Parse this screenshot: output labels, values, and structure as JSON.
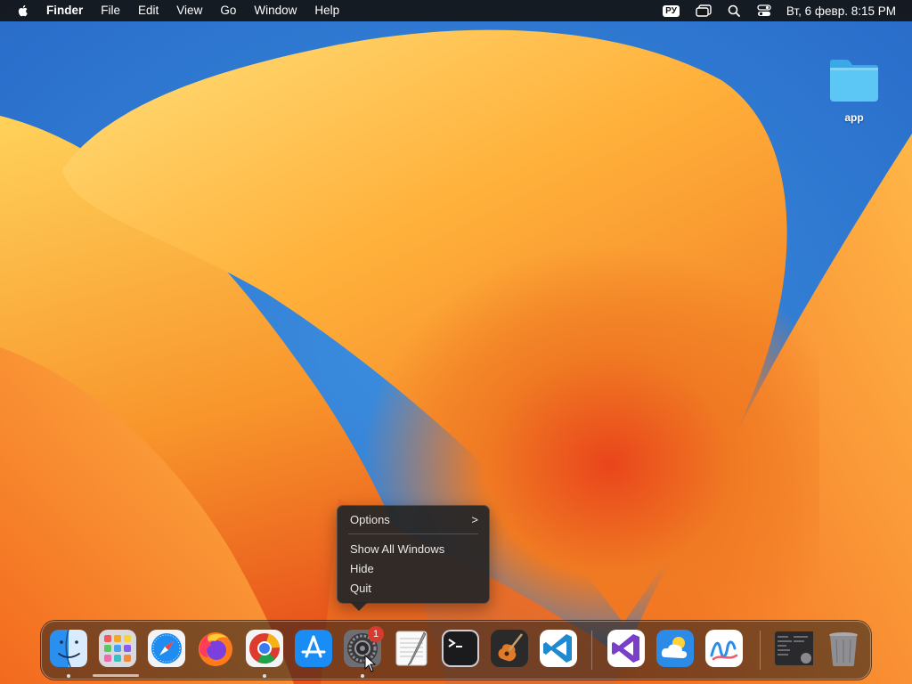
{
  "menubar": {
    "app_name": "Finder",
    "menus": [
      "File",
      "Edit",
      "View",
      "Go",
      "Window",
      "Help"
    ],
    "input_source": "РУ",
    "datetime": "Вт, 6 февр.  8:15 PM"
  },
  "desktop": {
    "folder_label": "app"
  },
  "context_menu": {
    "items": [
      "Options",
      "Show All Windows",
      "Hide",
      "Quit"
    ],
    "submenu_arrow": ">"
  },
  "dock": {
    "apps": [
      "finder-icon",
      "launchpad-icon",
      "safari-icon",
      "firefox-icon",
      "chrome-icon",
      "app-store-icon",
      "system-settings-icon",
      "textedit-icon",
      "terminal-icon",
      "garageband-icon",
      "vscode-icon",
      "visual-studio-icon",
      "weather-icon",
      "freeform-icon",
      "screenshot-icon",
      "trash-icon"
    ],
    "badge_count": "1"
  },
  "colors": {
    "menubar_bg": "#141414",
    "menu_bg": "#262626",
    "badge_red": "#d63b30",
    "folder_blue": "#4fc3f7"
  }
}
